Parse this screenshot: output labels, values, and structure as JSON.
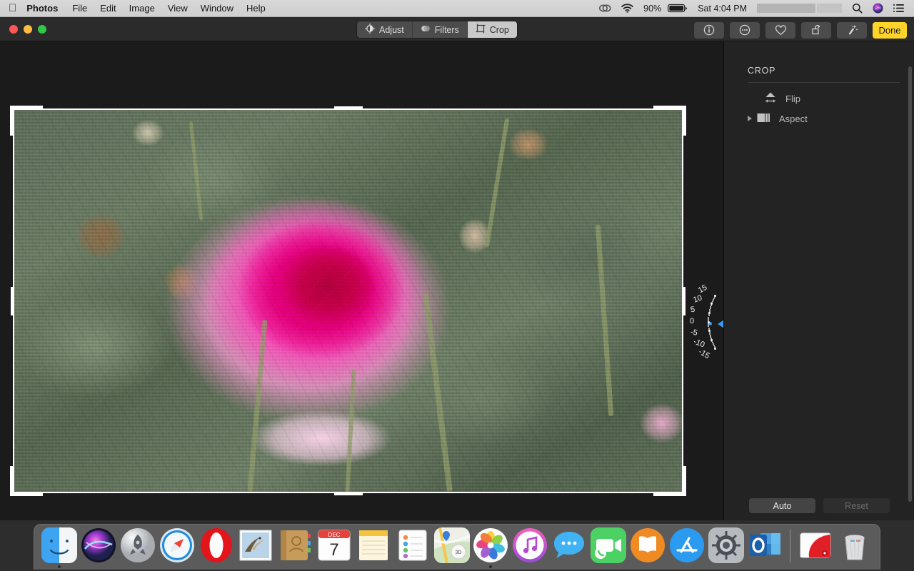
{
  "menubar": {
    "apple_glyph": "apple-logo",
    "app_name": "Photos",
    "items": [
      "File",
      "Edit",
      "Image",
      "View",
      "Window",
      "Help"
    ],
    "status": {
      "creative_cloud_icon": "creative-cloud-icon",
      "wifi_icon": "wifi-icon",
      "battery_percent": "90%",
      "battery_icon": "battery-icon",
      "datetime": "Sat 4:04 PM",
      "redacted_user": "",
      "search_icon": "search-icon",
      "siri_icon": "siri-icon",
      "notification_center_icon": "list-icon"
    }
  },
  "window": {
    "traffic_lights": {
      "close": "#fc5754",
      "minimize": "#fdbc40",
      "zoom": "#33c748"
    },
    "segmented": {
      "items": [
        {
          "label": "Adjust",
          "icon": "adjust-icon",
          "active": false
        },
        {
          "label": "Filters",
          "icon": "filters-icon",
          "active": false
        },
        {
          "label": "Crop",
          "icon": "crop-icon",
          "active": true
        }
      ]
    },
    "toolbar_right": {
      "info_icon": "info-icon",
      "more_icon": "ellipsis-icon",
      "favorite_icon": "heart-icon",
      "rotate_icon": "rotate-icon",
      "enhance_icon": "magic-wand-icon",
      "done_label": "Done",
      "done_color": "#ffd42a"
    }
  },
  "editor": {
    "photo_alt": "pink-magenta-rose-in-garden",
    "crop_overlay": "crop-frame-with-handles",
    "rotation": {
      "value": 0,
      "unit": "degrees",
      "labels": [
        "15",
        "10",
        "5",
        "0",
        "-5",
        "-10",
        "-15"
      ],
      "marker_color": "#3c9ae8"
    }
  },
  "sidebar": {
    "title": "CROP",
    "rows": [
      {
        "label": "Flip",
        "icon": "flip-icon",
        "has_disclosure": false
      },
      {
        "label": "Aspect",
        "icon": "aspect-icon",
        "has_disclosure": true
      }
    ],
    "footer": {
      "auto_label": "Auto",
      "reset_label": "Reset",
      "reset_disabled": true
    }
  },
  "dock": {
    "items": [
      {
        "name": "finder",
        "label": "Finder",
        "running": true
      },
      {
        "name": "siri",
        "label": "Siri",
        "running": false
      },
      {
        "name": "launchpad",
        "label": "Launchpad",
        "running": false
      },
      {
        "name": "safari",
        "label": "Safari",
        "running": false
      },
      {
        "name": "opera",
        "label": "Opera",
        "running": false
      },
      {
        "name": "mail",
        "label": "Mail",
        "running": false
      },
      {
        "name": "contacts",
        "label": "Contacts",
        "running": false
      },
      {
        "name": "calendar",
        "label": "Calendar",
        "running": false,
        "month": "DEC",
        "day": "7"
      },
      {
        "name": "notes",
        "label": "Notes",
        "running": false
      },
      {
        "name": "reminders",
        "label": "Reminders",
        "running": false
      },
      {
        "name": "maps",
        "label": "Maps",
        "running": false
      },
      {
        "name": "photos",
        "label": "Photos",
        "running": true
      },
      {
        "name": "itunes",
        "label": "iTunes",
        "running": false
      },
      {
        "name": "messages",
        "label": "Messages",
        "running": false
      },
      {
        "name": "facetime",
        "label": "FaceTime",
        "running": false
      },
      {
        "name": "books",
        "label": "Books",
        "running": false
      },
      {
        "name": "app-store",
        "label": "App Store",
        "running": false
      },
      {
        "name": "system-preferences",
        "label": "System Preferences",
        "running": false
      },
      {
        "name": "outlook",
        "label": "Outlook",
        "running": false
      }
    ],
    "right_items": [
      {
        "name": "downloads-folder",
        "label": "Downloads"
      },
      {
        "name": "trash",
        "label": "Trash"
      }
    ]
  }
}
